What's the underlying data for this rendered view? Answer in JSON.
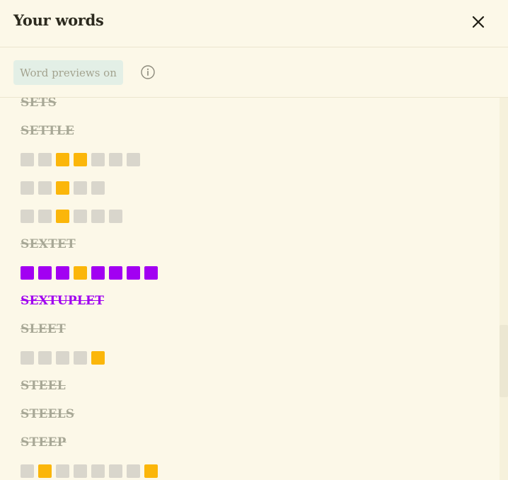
{
  "header": {
    "title": "Your words"
  },
  "toolbar": {
    "previews_label": "Word previews on"
  },
  "icons": {
    "close": "close-icon",
    "info": "info-icon"
  },
  "colors": {
    "background": "#fcf8e8",
    "empty": "#d9d6cc",
    "yellow": "#fbb60a",
    "purple": "#a200f2",
    "crossed_word": "#a8a896"
  },
  "rows": [
    {
      "type": "word",
      "text": "SETS"
    },
    {
      "type": "word",
      "text": "SETTLE"
    },
    {
      "type": "tiles",
      "tiles": [
        "e",
        "e",
        "y",
        "y",
        "e",
        "e",
        "e"
      ]
    },
    {
      "type": "tiles",
      "tiles": [
        "e",
        "e",
        "y",
        "e",
        "e"
      ]
    },
    {
      "type": "tiles",
      "tiles": [
        "e",
        "e",
        "y",
        "e",
        "e",
        "e"
      ]
    },
    {
      "type": "word",
      "text": "SEXTET"
    },
    {
      "type": "tiles",
      "tiles": [
        "p",
        "p",
        "p",
        "y",
        "p",
        "p",
        "p",
        "p"
      ]
    },
    {
      "type": "word",
      "text": "SEXTUPLET",
      "color": "purple"
    },
    {
      "type": "word",
      "text": "SLEET"
    },
    {
      "type": "tiles",
      "tiles": [
        "e",
        "e",
        "e",
        "e",
        "y"
      ]
    },
    {
      "type": "word",
      "text": "STEEL"
    },
    {
      "type": "word",
      "text": "STEELS"
    },
    {
      "type": "word",
      "text": "STEEP"
    },
    {
      "type": "tiles",
      "tiles": [
        "e",
        "y",
        "e",
        "e",
        "e",
        "e",
        "e",
        "y"
      ]
    }
  ]
}
